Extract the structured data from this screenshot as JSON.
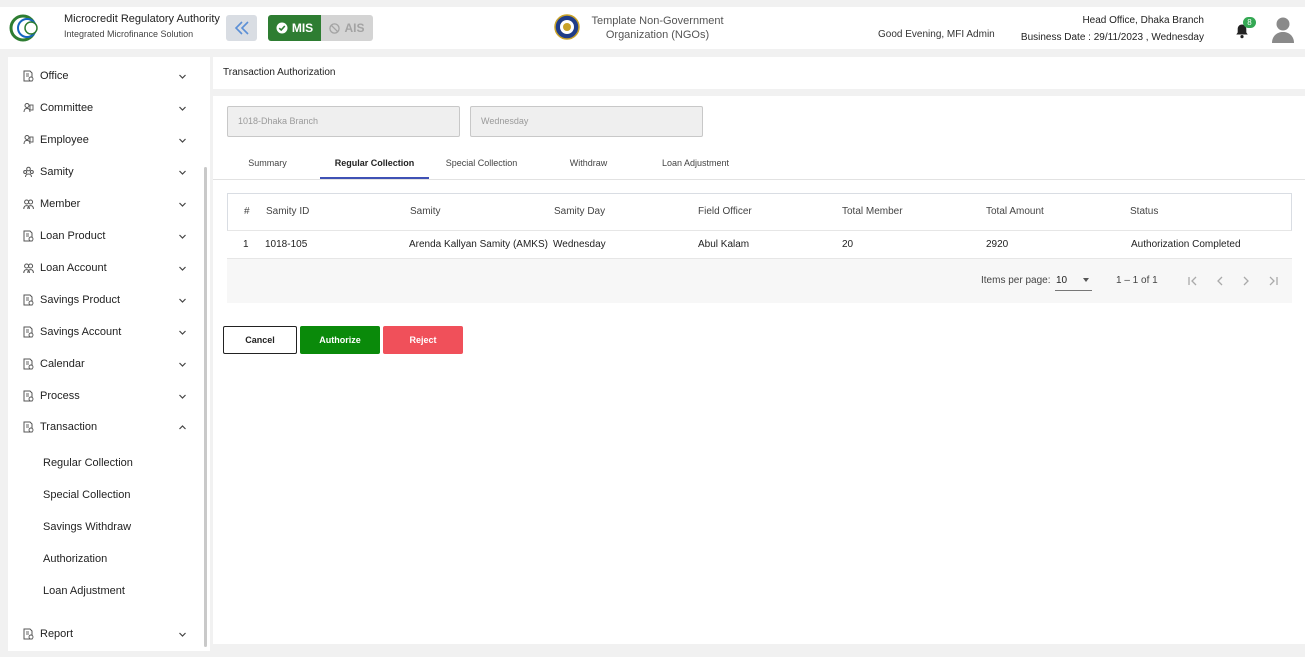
{
  "header": {
    "brand_title": "Microcredit Regulatory Authority",
    "brand_subtitle": "Integrated Microfinance Solution",
    "logo_text": "Microcredit Regulatory Authority",
    "mode_mis": "MIS",
    "mode_ais": "AIS",
    "org_name_line1": "Template Non-Government",
    "org_name_line2": "Organization (NGOs)",
    "greeting": "Good Evening, MFI Admin",
    "branch": "Head Office, Dhaka Branch",
    "business_date": "Business Date : 29/11/2023 , Wednesday",
    "notification_count": "8",
    "accent_color": "#2e7d32"
  },
  "sidebar": {
    "items": [
      {
        "label": "Office",
        "icon": "doc-gear-icon"
      },
      {
        "label": "Committee",
        "icon": "people-icon"
      },
      {
        "label": "Employee",
        "icon": "people-icon"
      },
      {
        "label": "Samity",
        "icon": "group-icon"
      },
      {
        "label": "Member",
        "icon": "members-icon"
      },
      {
        "label": "Loan Product",
        "icon": "doc-gear-icon"
      },
      {
        "label": "Loan Account",
        "icon": "members-icon"
      },
      {
        "label": "Savings Product",
        "icon": "doc-gear-icon"
      },
      {
        "label": "Savings Account",
        "icon": "doc-gear-icon"
      },
      {
        "label": "Calendar",
        "icon": "doc-gear-icon"
      },
      {
        "label": "Process",
        "icon": "doc-gear-icon"
      },
      {
        "label": "Transaction",
        "icon": "doc-gear-icon"
      }
    ],
    "transaction_sub": [
      "Regular Collection",
      "Special Collection",
      "Savings Withdraw",
      "Authorization",
      "Loan Adjustment"
    ],
    "report": {
      "label": "Report",
      "icon": "doc-gear-icon"
    }
  },
  "page": {
    "breadcrumb": "Transaction Authorization",
    "branch_field": "1018-Dhaka Branch",
    "day_field": "Wednesday",
    "tabs": [
      "Summary",
      "Regular Collection",
      "Special Collection",
      "Withdraw",
      "Loan Adjustment"
    ],
    "active_tab": "Regular Collection"
  },
  "table": {
    "columns": [
      "#",
      "Samity ID",
      "Samity",
      "Samity Day",
      "Field Officer",
      "Total Member",
      "Total Amount",
      "Status"
    ],
    "rows": [
      [
        "1",
        "1018-105",
        "Arenda Kallyan Samity (AMKS)",
        "Wednesday",
        "Abul Kalam",
        "20",
        "2920",
        "Authorization Completed"
      ]
    ],
    "paginator": {
      "items_per_page_label": "Items per page:",
      "items_per_page": "10",
      "range": "1 – 1 of 1"
    }
  },
  "actions": {
    "cancel": "Cancel",
    "authorize": "Authorize",
    "reject": "Reject"
  }
}
